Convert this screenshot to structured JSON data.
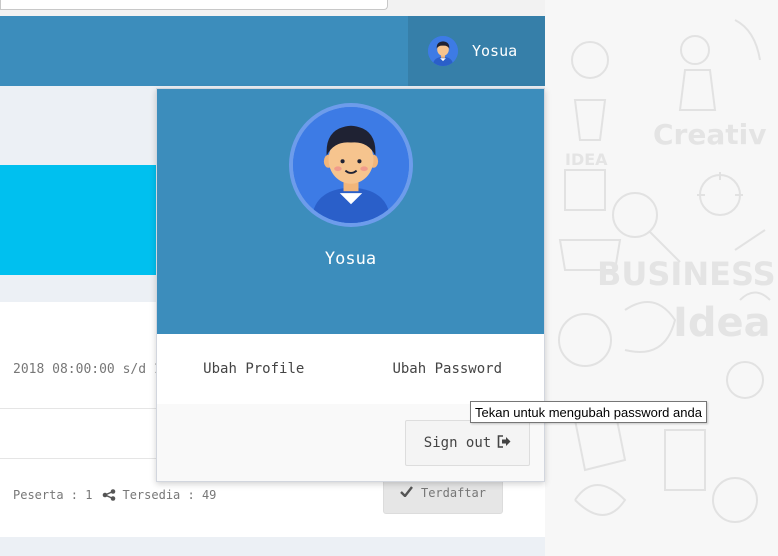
{
  "user": {
    "name": "Yosua"
  },
  "dropdown": {
    "name": "Yosua",
    "edit_profile": "Ubah Profile",
    "change_password": "Ubah Password",
    "sign_out": "Sign out"
  },
  "tooltip": {
    "text": "Tekan untuk mengubah password anda"
  },
  "event_card": {
    "date_range": "2018 08:00:00 s/d 1",
    "participants": "Peserta : 1",
    "available": "Tersedia : 49",
    "status_button": "Terdaftar"
  },
  "background": {
    "words": [
      "Creativ",
      "IDEA",
      "BUSINESS",
      "Idea"
    ]
  },
  "colors": {
    "primary": "#3c8dbc",
    "primary_dark": "#367fa9",
    "info": "#00c0ef",
    "avatar_bg": "#3d7be5"
  },
  "icons": {
    "share": "share-icon",
    "check": "check-icon",
    "sign_out": "sign-out-icon"
  }
}
